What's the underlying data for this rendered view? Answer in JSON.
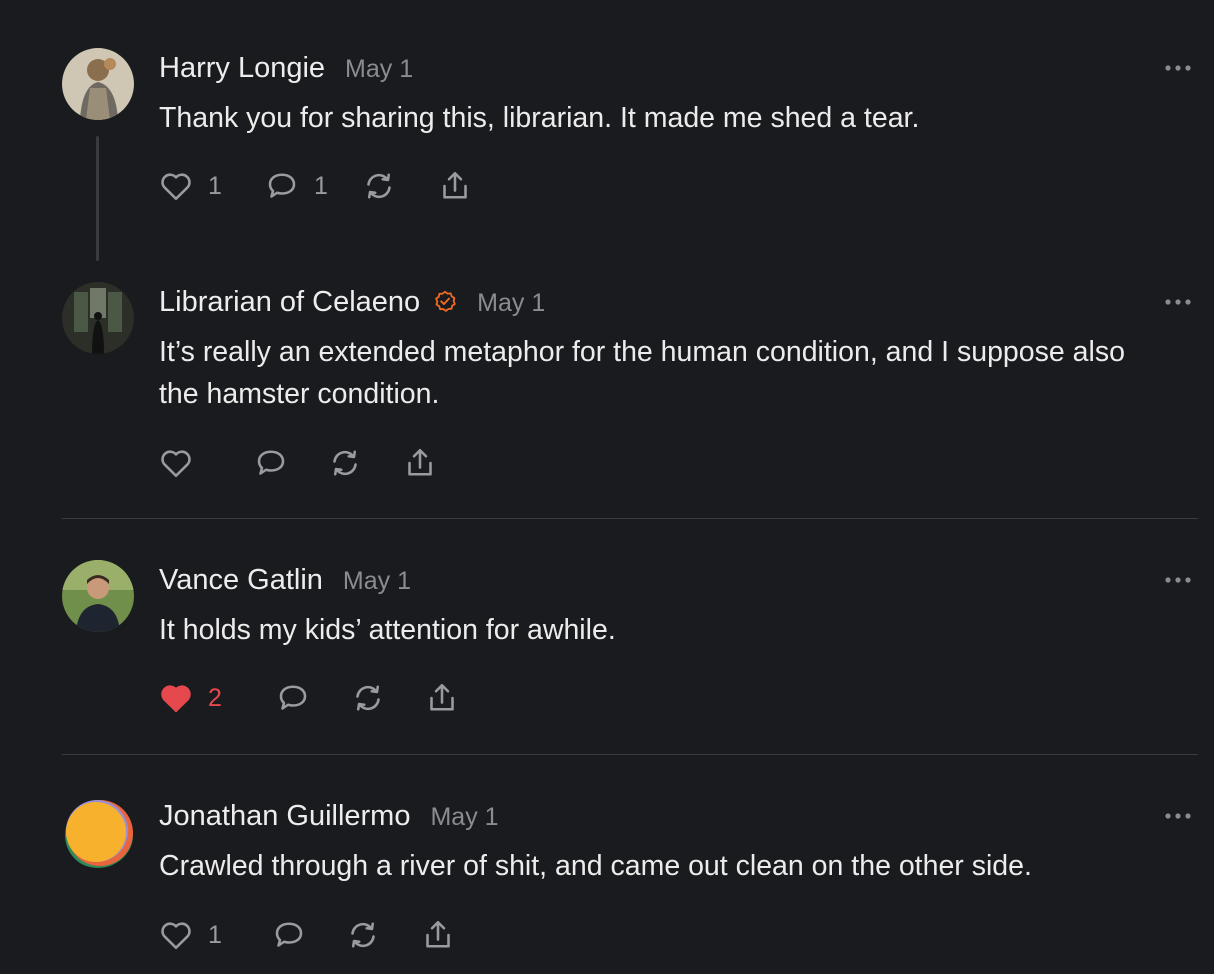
{
  "accent": {
    "liked": "#e5484d",
    "verified": "#f26b21"
  },
  "comments": [
    {
      "name": "Harry Longie",
      "date": "May 1",
      "text": "Thank you for sharing this, librarian. It made me shed a tear.",
      "likes": "1",
      "replies": "1",
      "liked": false
    },
    {
      "name": "Librarian of Celaeno",
      "verified": true,
      "date": "May 1",
      "text": "It’s really an extended metaphor for the human condition, and I suppose also the hamster condition.",
      "likes": "",
      "replies": "",
      "liked": false
    },
    {
      "name": "Vance Gatlin",
      "date": "May 1",
      "text": "It holds my kids’ attention for awhile.",
      "likes": "2",
      "replies": "",
      "liked": true
    },
    {
      "name": "Jonathan Guillermo",
      "date": "May 1",
      "text": "Crawled through a river of shit, and came out clean on the other side.",
      "likes": "1",
      "replies": "",
      "liked": false
    }
  ],
  "icons": {
    "like": "heart-icon",
    "reply": "comment-bubble-icon",
    "restack": "restack-icon",
    "share": "share-icon",
    "more": "more-horizontal-icon",
    "verified": "verified-badge-icon"
  }
}
